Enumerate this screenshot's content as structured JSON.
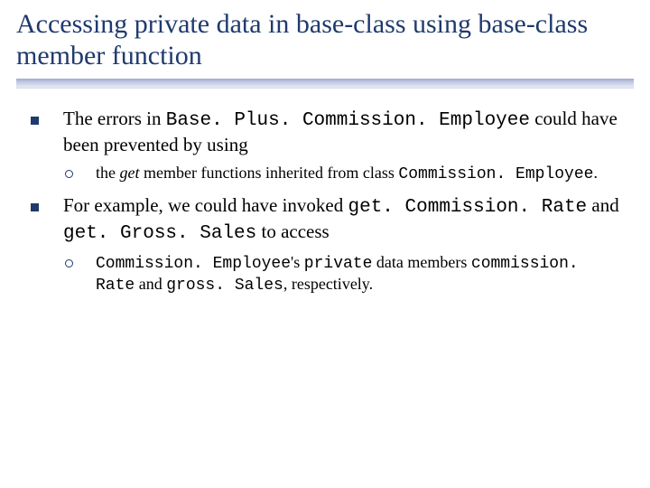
{
  "title": "Accessing private data in base-class using base-class member function",
  "b1_a": "The errors in ",
  "b1_code": "Base. Plus. Commission. Employee",
  "b1_b": " could have been prevented by using",
  "b1_s1_a": "the ",
  "b1_s1_i": "get",
  "b1_s1_b": " member functions inherited from class ",
  "b1_s1_code": "Commission. Employee",
  "b1_s1_c": ".",
  "b2_a": "For example, we could have invoked ",
  "b2_code1": "get. Commission. Rate",
  "b2_b": " and ",
  "b2_code2": "get. Gross. Sales",
  "b2_c": " to access",
  "b2_s1_code1": "Commission. Employee",
  "b2_s1_a": "'s ",
  "b2_s1_code2": "private",
  "b2_s1_b": " data members ",
  "b2_s1_code3": "commission. Rate",
  "b2_s1_c": " and ",
  "b2_s1_code4": "gross. Sales",
  "b2_s1_d": ", respectively."
}
